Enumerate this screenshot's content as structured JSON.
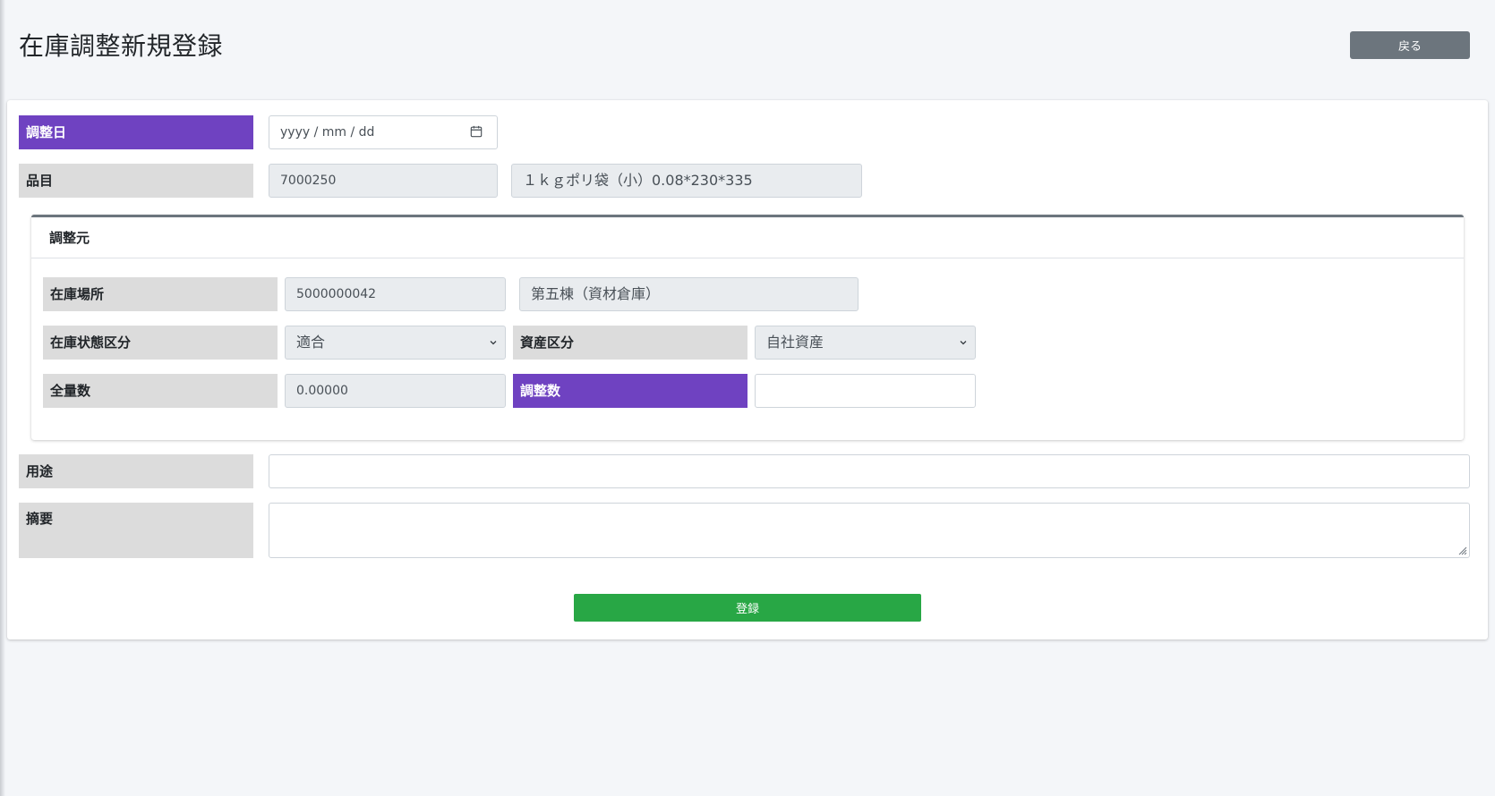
{
  "header": {
    "title": "在庫調整新規登録",
    "back_label": "戻る"
  },
  "form": {
    "adjust_date": {
      "label": "調整日",
      "placeholder": "yyyy / mm / dd"
    },
    "item": {
      "label": "品目",
      "code": "7000250",
      "name": "１ｋｇポリ袋（小）0.08*230*335"
    },
    "source": {
      "title": "調整元",
      "location": {
        "label": "在庫場所",
        "code": "5000000042",
        "name": "第五棟（資材倉庫）"
      },
      "stock_status": {
        "label": "在庫状態区分",
        "value": "適合"
      },
      "asset_type": {
        "label": "資産区分",
        "value": "自社資産"
      },
      "total_qty": {
        "label": "全量数",
        "value": "0.00000"
      },
      "adjust_qty": {
        "label": "調整数",
        "value": ""
      }
    },
    "purpose": {
      "label": "用途",
      "value": ""
    },
    "summary": {
      "label": "摘要",
      "value": ""
    },
    "submit_label": "登録"
  },
  "colors": {
    "required_label": "#6f42c1",
    "label_bg": "#dcdcdc",
    "submit": "#28a745",
    "back": "#6c757d"
  },
  "icons": [
    "calendar-icon",
    "chevron-down-icon",
    "resize-grip-icon"
  ]
}
